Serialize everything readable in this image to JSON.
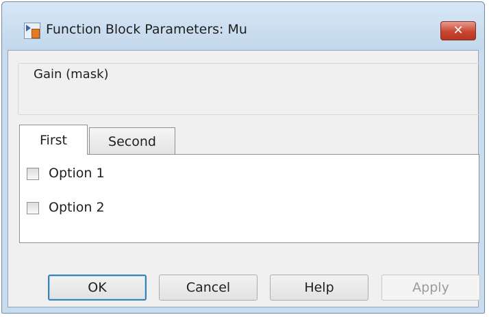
{
  "window": {
    "title": "Function Block Parameters: Mu",
    "close_label": "✕"
  },
  "group": {
    "title": "Gain (mask)"
  },
  "tabs": [
    {
      "label": "First",
      "selected": true
    },
    {
      "label": "Second",
      "selected": false
    }
  ],
  "options": [
    {
      "label": "Option 1",
      "checked": false
    },
    {
      "label": "Option 2",
      "checked": false
    }
  ],
  "buttons": {
    "ok": "OK",
    "cancel": "Cancel",
    "help": "Help",
    "apply": "Apply"
  },
  "colors": {
    "close_button": "#c84630",
    "default_button_border": "#3c7fb1"
  }
}
